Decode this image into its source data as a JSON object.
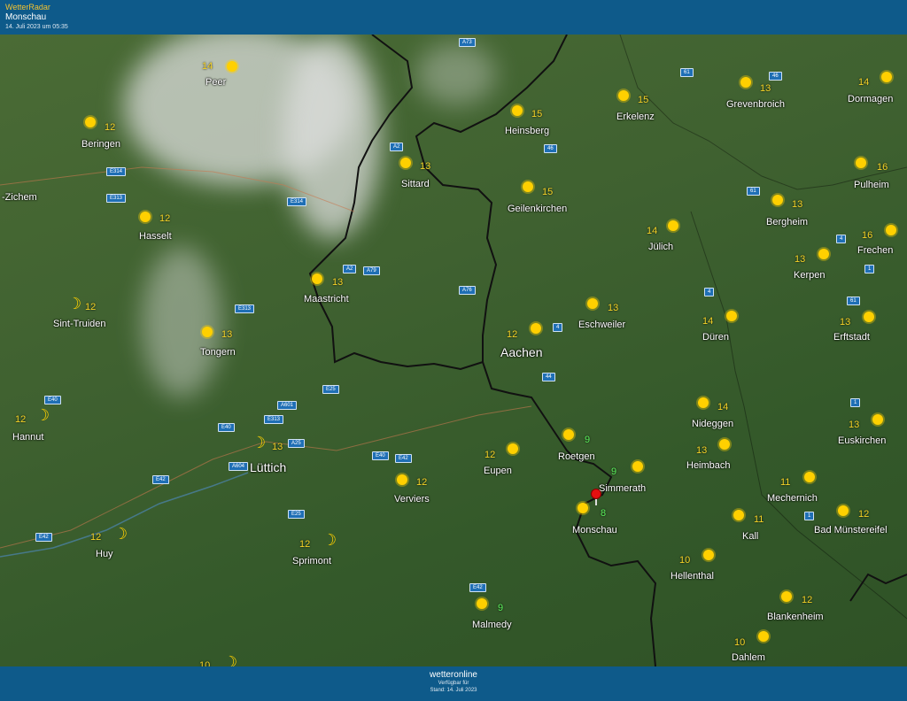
{
  "header": {
    "brand": "WetterRadar",
    "location": "Monschau",
    "timestamp": "14. Juli 2023 um 05:35"
  },
  "footer": {
    "logo": "wetteronline",
    "line1": "Verfügbar für",
    "line2": "Stand: 14. Juli 2023"
  },
  "roads": [
    "A73",
    "61",
    "46",
    "46",
    "A2",
    "E314",
    "E313",
    "E314",
    "61",
    "A2",
    "A79",
    "4",
    "1",
    "A76",
    "E313",
    "E40",
    "4",
    "61",
    "44",
    "4",
    "E25",
    "A601",
    "E313",
    "A25",
    "E40",
    "E40",
    "E42",
    "E42",
    "A604",
    "E25",
    "E42",
    "E42",
    "1",
    "1"
  ],
  "cities": [
    {
      "name": "Peer",
      "temp": "14",
      "icon": "sun"
    },
    {
      "name": "Beringen",
      "temp": "12",
      "icon": "sun"
    },
    {
      "name": "-Zichem",
      "temp": "",
      "icon": ""
    },
    {
      "name": "Hasselt",
      "temp": "12",
      "icon": "sun"
    },
    {
      "name": "Sint-Truiden",
      "temp": "12",
      "icon": "moon"
    },
    {
      "name": "Tongern",
      "temp": "13",
      "icon": "sun"
    },
    {
      "name": "Hannut",
      "temp": "12",
      "icon": "moon"
    },
    {
      "name": "Lüttich",
      "temp": "13",
      "icon": "moon"
    },
    {
      "name": "Huy",
      "temp": "12",
      "icon": "moon"
    },
    {
      "name": "Sprimont",
      "temp": "12",
      "icon": "moon"
    },
    {
      "name": "Maastricht",
      "temp": "13",
      "icon": "sun"
    },
    {
      "name": "Sittard",
      "temp": "13",
      "icon": "sun"
    },
    {
      "name": "Heinsberg",
      "temp": "15",
      "icon": "sun"
    },
    {
      "name": "Geilenkirchen",
      "temp": "15",
      "icon": "sun"
    },
    {
      "name": "Erkelenz",
      "temp": "15",
      "icon": "sun"
    },
    {
      "name": "Grevenbroich",
      "temp": "13",
      "icon": "sun"
    },
    {
      "name": "Dormagen",
      "temp": "14",
      "icon": "sun"
    },
    {
      "name": "Pulheim",
      "temp": "16",
      "icon": "sun"
    },
    {
      "name": "Bergheim",
      "temp": "13",
      "icon": "sun"
    },
    {
      "name": "Frechen",
      "temp": "16",
      "icon": "sun"
    },
    {
      "name": "Jülich",
      "temp": "14",
      "icon": "sun"
    },
    {
      "name": "Kerpen",
      "temp": "13",
      "icon": "sun"
    },
    {
      "name": "Aachen",
      "temp": "12",
      "icon": "sun"
    },
    {
      "name": "Eschweiler",
      "temp": "13",
      "icon": "sun"
    },
    {
      "name": "Düren",
      "temp": "14",
      "icon": "sun"
    },
    {
      "name": "Erftstadt",
      "temp": "13",
      "icon": "sun"
    },
    {
      "name": "Eupen",
      "temp": "12",
      "icon": "sun"
    },
    {
      "name": "Verviers",
      "temp": "12",
      "icon": "sun"
    },
    {
      "name": "Roetgen",
      "temp": "9",
      "icon": "sun"
    },
    {
      "name": "Simmerath",
      "temp": "9",
      "icon": "sun"
    },
    {
      "name": "Monschau",
      "temp": "8",
      "icon": "sun"
    },
    {
      "name": "Nideggen",
      "temp": "14",
      "icon": "sun"
    },
    {
      "name": "Heimbach",
      "temp": "13",
      "icon": "sun"
    },
    {
      "name": "Euskirchen",
      "temp": "13",
      "icon": "sun"
    },
    {
      "name": "Mechernich",
      "temp": "11",
      "icon": "sun"
    },
    {
      "name": "Kall",
      "temp": "11",
      "icon": "sun"
    },
    {
      "name": "Bad Münstereifel",
      "temp": "12",
      "icon": "sun"
    },
    {
      "name": "Hellenthal",
      "temp": "10",
      "icon": "sun"
    },
    {
      "name": "Malmedy",
      "temp": "9",
      "icon": "sun"
    },
    {
      "name": "Blankenheim",
      "temp": "12",
      "icon": "sun"
    },
    {
      "name": "Dahlem",
      "temp": "10",
      "icon": "sun"
    },
    {
      "name": "",
      "temp": "10",
      "icon": "moon"
    }
  ]
}
